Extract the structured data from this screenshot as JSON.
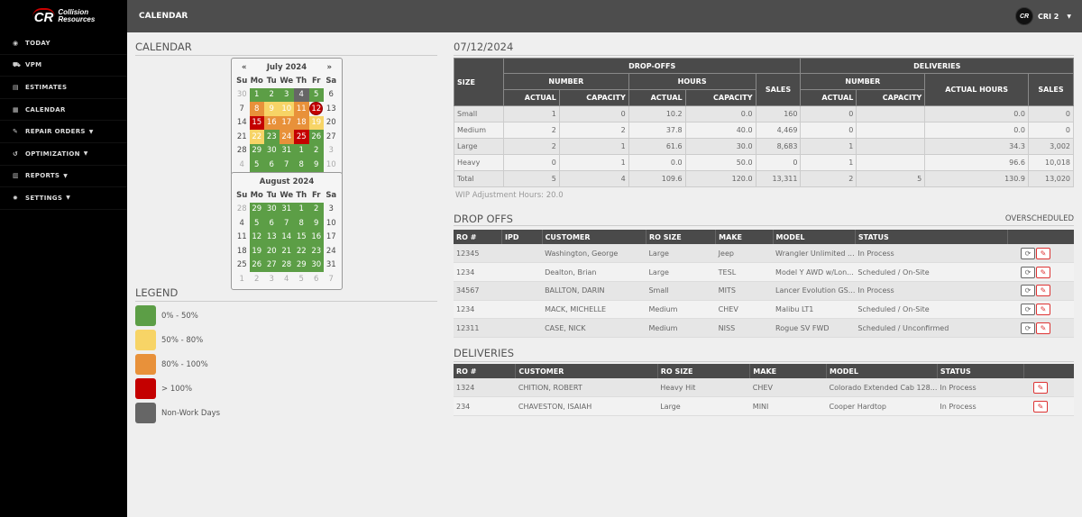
{
  "brand": {
    "mark": "CR",
    "name_line1": "Collision",
    "name_line2": "Resources"
  },
  "sidebar": {
    "items": [
      {
        "label": "TODAY",
        "icon": "dashboard-icon",
        "caret": false
      },
      {
        "label": "VPM",
        "icon": "car-icon",
        "caret": false
      },
      {
        "label": "ESTIMATES",
        "icon": "id-card-icon",
        "caret": false
      },
      {
        "label": "CALENDAR",
        "icon": "calendar-icon",
        "caret": false
      },
      {
        "label": "REPAIR ORDERS",
        "icon": "wrench-icon",
        "caret": true
      },
      {
        "label": "OPTIMIZATION",
        "icon": "history-icon",
        "caret": true
      },
      {
        "label": "REPORTS",
        "icon": "bar-chart-icon",
        "caret": true
      },
      {
        "label": "SETTINGS",
        "icon": "gear-icon",
        "caret": true
      }
    ]
  },
  "header": {
    "title": "CALENDAR",
    "user": "CRI 2",
    "avatar": "CR"
  },
  "calendar": {
    "title": "CALENDAR",
    "dow": [
      "Su",
      "Mo",
      "Tu",
      "We",
      "Th",
      "Fr",
      "Sa"
    ],
    "prev": "«",
    "next": "»",
    "months": [
      {
        "title": "July 2024",
        "days": [
          [
            "30",
            "o"
          ],
          [
            "1",
            "g"
          ],
          [
            "2",
            "g"
          ],
          [
            "3",
            "g"
          ],
          [
            "4",
            "n"
          ],
          [
            "5",
            "g"
          ],
          [
            "6",
            "p"
          ],
          [
            "7",
            "p"
          ],
          [
            "8",
            "or"
          ],
          [
            "9",
            "y"
          ],
          [
            "10",
            "y"
          ],
          [
            "11",
            "or"
          ],
          [
            "12",
            "sel"
          ],
          [
            "13",
            "p"
          ],
          [
            "14",
            "p"
          ],
          [
            "15",
            "r"
          ],
          [
            "16",
            "or"
          ],
          [
            "17",
            "or"
          ],
          [
            "18",
            "or"
          ],
          [
            "19",
            "y"
          ],
          [
            "20",
            "p"
          ],
          [
            "21",
            "p"
          ],
          [
            "22",
            "y"
          ],
          [
            "23",
            "g"
          ],
          [
            "24",
            "or"
          ],
          [
            "25",
            "r"
          ],
          [
            "26",
            "g"
          ],
          [
            "27",
            "p"
          ],
          [
            "28",
            "p"
          ],
          [
            "29",
            "g"
          ],
          [
            "30",
            "g"
          ],
          [
            "31",
            "g"
          ],
          [
            "1",
            "g"
          ],
          [
            "2",
            "g"
          ],
          [
            "3",
            "o"
          ],
          [
            "4",
            "o"
          ],
          [
            "5",
            "g"
          ],
          [
            "6",
            "g"
          ],
          [
            "7",
            "g"
          ],
          [
            "8",
            "g"
          ],
          [
            "9",
            "g"
          ],
          [
            "10",
            "o"
          ]
        ]
      },
      {
        "title": "August 2024",
        "days": [
          [
            "28",
            "o"
          ],
          [
            "29",
            "g"
          ],
          [
            "30",
            "g"
          ],
          [
            "31",
            "g"
          ],
          [
            "1",
            "g"
          ],
          [
            "2",
            "g"
          ],
          [
            "3",
            "p"
          ],
          [
            "4",
            "p"
          ],
          [
            "5",
            "g"
          ],
          [
            "6",
            "g"
          ],
          [
            "7",
            "g"
          ],
          [
            "8",
            "g"
          ],
          [
            "9",
            "g"
          ],
          [
            "10",
            "p"
          ],
          [
            "11",
            "p"
          ],
          [
            "12",
            "g"
          ],
          [
            "13",
            "g"
          ],
          [
            "14",
            "g"
          ],
          [
            "15",
            "g"
          ],
          [
            "16",
            "g"
          ],
          [
            "17",
            "p"
          ],
          [
            "18",
            "p"
          ],
          [
            "19",
            "g"
          ],
          [
            "20",
            "g"
          ],
          [
            "21",
            "g"
          ],
          [
            "22",
            "g"
          ],
          [
            "23",
            "g"
          ],
          [
            "24",
            "p"
          ],
          [
            "25",
            "p"
          ],
          [
            "26",
            "g"
          ],
          [
            "27",
            "g"
          ],
          [
            "28",
            "g"
          ],
          [
            "29",
            "g"
          ],
          [
            "30",
            "g"
          ],
          [
            "31",
            "p"
          ],
          [
            "1",
            "o"
          ],
          [
            "2",
            "o"
          ],
          [
            "3",
            "o"
          ],
          [
            "4",
            "o"
          ],
          [
            "5",
            "o"
          ],
          [
            "6",
            "o"
          ],
          [
            "7",
            "o"
          ]
        ]
      }
    ]
  },
  "legend": {
    "title": "LEGEND",
    "items": [
      {
        "label": "0% - 50%",
        "color": "#5c9e46"
      },
      {
        "label": "50% - 80%",
        "color": "#f7d466"
      },
      {
        "label": "80% - 100%",
        "color": "#e8913a"
      },
      {
        "label": "> 100%",
        "color": "#c40000"
      },
      {
        "label": "Non-Work Days",
        "color": "#666666"
      }
    ]
  },
  "summary": {
    "date": "07/12/2024",
    "h_size": "SIZE",
    "h_dropoffs": "DROP-OFFS",
    "h_deliveries": "DELIVERIES",
    "h_number": "NUMBER",
    "h_hours": "HOURS",
    "h_sales": "SALES",
    "h_actual": "ACTUAL",
    "h_capacity": "CAPACITY",
    "h_actual_hours": "ACTUAL HOURS",
    "rows": [
      [
        "Small",
        "1",
        "0",
        "10.2",
        "0.0",
        "160",
        "0",
        "",
        "0.0",
        "0"
      ],
      [
        "Medium",
        "2",
        "2",
        "37.8",
        "40.0",
        "4,469",
        "0",
        "",
        "0.0",
        "0"
      ],
      [
        "Large",
        "2",
        "1",
        "61.6",
        "30.0",
        "8,683",
        "1",
        "",
        "34.3",
        "3,002"
      ],
      [
        "Heavy",
        "0",
        "1",
        "0.0",
        "50.0",
        "0",
        "1",
        "",
        "96.6",
        "10,018"
      ],
      [
        "Total",
        "5",
        "4",
        "109.6",
        "120.0",
        "13,311",
        "2",
        "5",
        "130.9",
        "13,020"
      ]
    ],
    "wip": "WIP Adjustment Hours: 20.0"
  },
  "dropoffs": {
    "title": "DROP OFFS",
    "flag": "OVERSCHEDULED",
    "columns": [
      "RO #",
      "IPD",
      "CUSTOMER",
      "RO SIZE",
      "MAKE",
      "MODEL",
      "STATUS",
      ""
    ],
    "rows": [
      [
        "12345",
        "",
        "Washington, George",
        "Large",
        "Jeep",
        "Wrangler Unlimited ...",
        "In Process"
      ],
      [
        "1234",
        "",
        "Dealton, Brian",
        "Large",
        "TESL",
        "Model Y AWD w/Lon...",
        "Scheduled / On-Site"
      ],
      [
        "34567",
        "",
        "BALLTON, DARIN",
        "Small",
        "MITS",
        "Lancer Evolution GS...",
        "In Process"
      ],
      [
        "1234",
        "",
        "MACK, MICHELLE",
        "Medium",
        "CHEV",
        "Malibu LT1",
        "Scheduled / On-Site"
      ],
      [
        "12311",
        "",
        "CASE, NICK",
        "Medium",
        "NISS",
        "Rogue SV FWD",
        "Scheduled / Unconfirmed"
      ]
    ]
  },
  "deliveries": {
    "title": "DELIVERIES",
    "columns": [
      "RO #",
      "CUSTOMER",
      "RO SIZE",
      "MAKE",
      "MODEL",
      "STATUS",
      ""
    ],
    "rows": [
      [
        "1324",
        "CHITION, ROBERT",
        "Heavy Hit",
        "CHEV",
        "Colorado Extended Cab 128...",
        "In Process"
      ],
      [
        "234",
        "CHAVESTON, ISAIAH",
        "Large",
        "MINI",
        "Cooper Hardtop",
        "In Process"
      ]
    ]
  }
}
